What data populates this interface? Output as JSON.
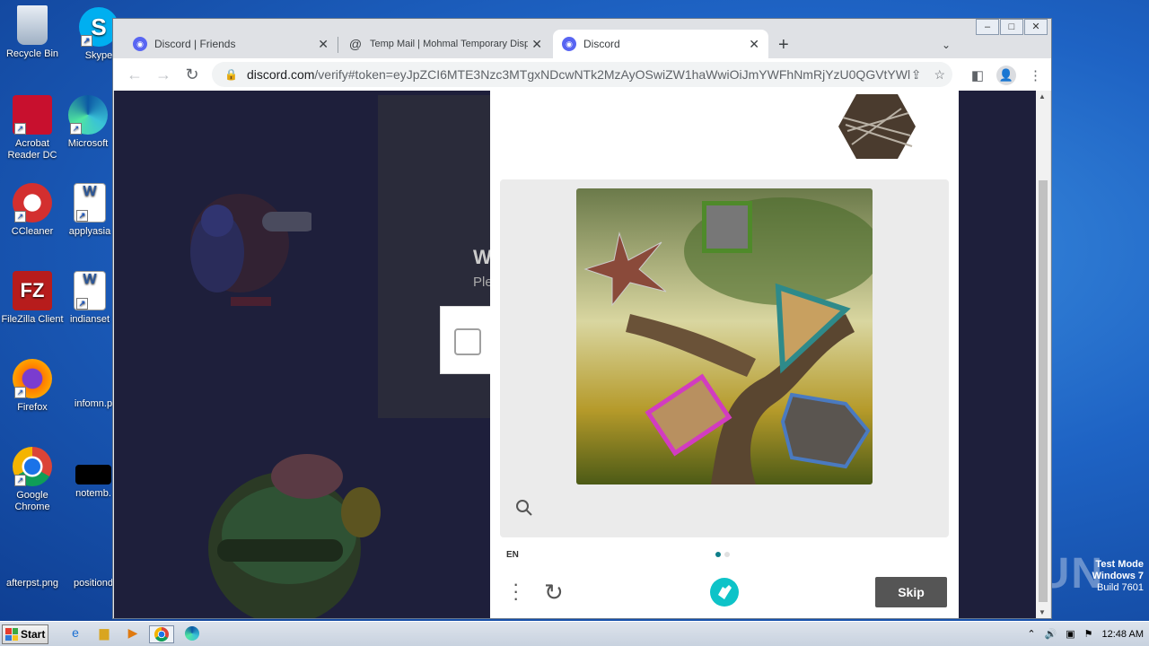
{
  "desktop": {
    "icons": [
      {
        "label": "Recycle Bin"
      },
      {
        "label": "Skype"
      },
      {
        "label": "Acrobat Reader DC"
      },
      {
        "label": "Microsoft"
      },
      {
        "label": "CCleaner"
      },
      {
        "label": "applyasia"
      },
      {
        "label": "FileZilla Client"
      },
      {
        "label": "indianset"
      },
      {
        "label": "Firefox"
      },
      {
        "label": "infomn.p"
      },
      {
        "label": "Google Chrome"
      },
      {
        "label": "notemb."
      },
      {
        "label": "afterpst.png"
      },
      {
        "label": "positiond"
      }
    ],
    "watermark": "ANY RUN",
    "test_mode": [
      "Test Mode",
      "Windows 7",
      "Build 7601"
    ]
  },
  "browser": {
    "tabs": [
      {
        "title": "Discord | Friends",
        "icon": "discord-icon"
      },
      {
        "title": "Temp Mail | Mohmal Temporary Dispo",
        "icon": "at-icon"
      },
      {
        "title": "Discord",
        "icon": "discord-icon",
        "active": true
      }
    ],
    "url_host": "discord.com",
    "url_path": "/verify#token=eyJpZCI6MTE3Nzc3MTgxNDcwNTk2MzAyOSwiZW1haWwiOiJmYWFhNmRjYzU0QGVtYWl...",
    "window_controls": [
      "–",
      "□",
      "✕"
    ]
  },
  "page": {
    "bg_heading": "W",
    "bg_text": "Ple"
  },
  "captcha": {
    "language": "EN",
    "skip_label": "Skip",
    "accent": "#0e7e8a"
  },
  "taskbar": {
    "start_label": "Start",
    "time": "12:48 AM"
  }
}
